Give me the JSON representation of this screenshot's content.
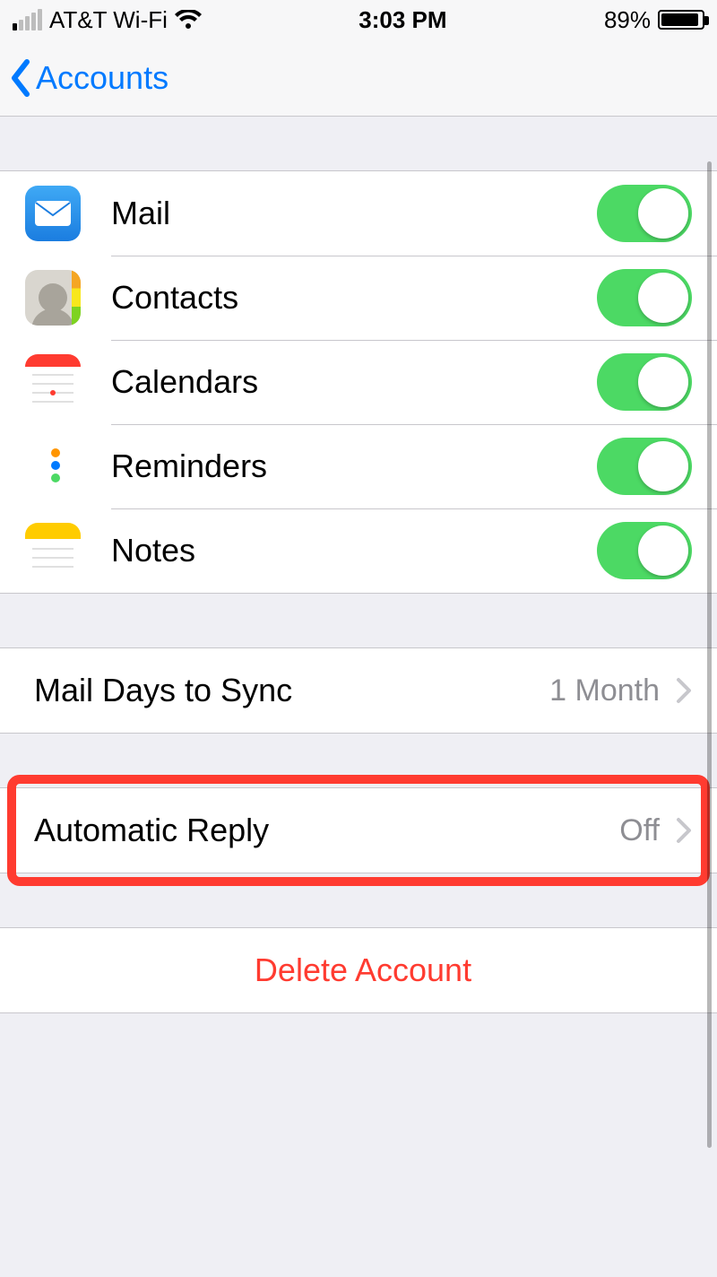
{
  "status_bar": {
    "carrier": "AT&T Wi-Fi",
    "time": "3:03 PM",
    "battery_pct": "89%"
  },
  "nav": {
    "back_label": "Accounts"
  },
  "services": [
    {
      "id": "mail",
      "label": "Mail",
      "on": true
    },
    {
      "id": "contacts",
      "label": "Contacts",
      "on": true
    },
    {
      "id": "calendars",
      "label": "Calendars",
      "on": true
    },
    {
      "id": "reminders",
      "label": "Reminders",
      "on": true
    },
    {
      "id": "notes",
      "label": "Notes",
      "on": true
    }
  ],
  "sync": {
    "label": "Mail Days to Sync",
    "value": "1 Month"
  },
  "auto_reply": {
    "label": "Automatic Reply",
    "value": "Off",
    "highlighted": true
  },
  "delete": {
    "label": "Delete Account"
  },
  "colors": {
    "tint": "#007aff",
    "toggle_on": "#4cd964",
    "destructive": "#ff3b30",
    "secondary_text": "#8e8e93"
  }
}
